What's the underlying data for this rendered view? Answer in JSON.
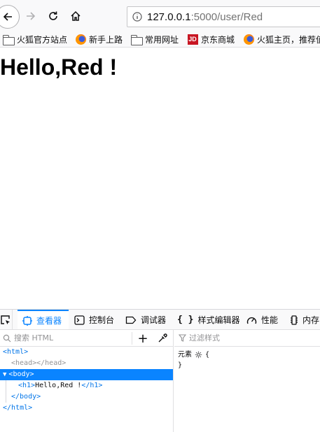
{
  "toolbar": {
    "url_host": "127.0.0.1",
    "url_path": ":5000/user/Red"
  },
  "bookmarks": [
    {
      "label": "火狐官方站点",
      "icon": "folder-icon"
    },
    {
      "label": "新手上路",
      "icon": "firefox-icon"
    },
    {
      "label": "常用网址",
      "icon": "folder-icon"
    },
    {
      "label": "京东商城",
      "icon": "jd-icon",
      "icon_text": "JD"
    },
    {
      "label": "火狐主页，推荐值",
      "icon": "firefox-icon"
    }
  ],
  "page": {
    "heading": "Hello,Red !"
  },
  "devtools": {
    "tabs": [
      {
        "label": "查看器",
        "icon": "inspector-icon",
        "selected": true
      },
      {
        "label": "控制台",
        "icon": "console-icon"
      },
      {
        "label": "调试器",
        "icon": "debugger-icon"
      },
      {
        "label": "样式编辑器",
        "icon": "style-editor-icon",
        "icon_text": "{ }"
      },
      {
        "label": "性能",
        "icon": "performance-icon"
      },
      {
        "label": "内存",
        "icon": "memory-icon"
      }
    ],
    "search_placeholder": "搜索 HTML",
    "add_label": "+",
    "tree": {
      "html_open": "<html>",
      "head": "<head></head>",
      "body_open": "<body>",
      "h1_open": "<h1>",
      "h1_text": "Hello,Red !",
      "h1_close": "</h1>",
      "body_close": "</body>",
      "html_close": "</html>"
    },
    "filter_placeholder": "过滤样式",
    "rule": {
      "selector": "元素",
      "open": "{",
      "close": "}"
    },
    "accent_color": "#0a84ff"
  }
}
